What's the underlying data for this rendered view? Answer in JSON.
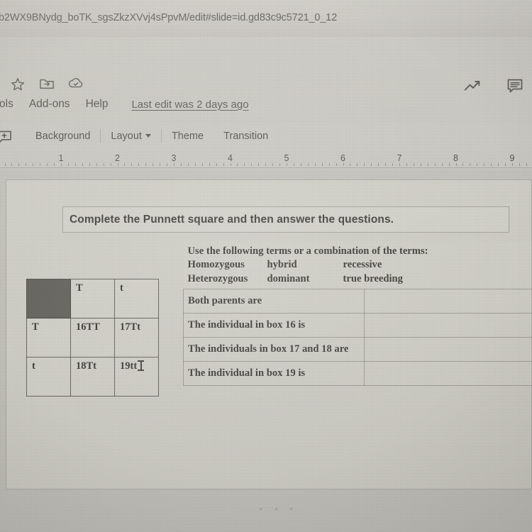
{
  "browser": {
    "url": "b2WX9BNydg_boTK_sgsZkzXVvj4sPpvM/edit#slide=id.gd83c9c5721_0_12"
  },
  "header": {
    "icons": [
      {
        "name": "star-icon",
        "label": "star"
      },
      {
        "name": "move-to-folder-icon",
        "label": "move to folder"
      },
      {
        "name": "cloud-saved-icon",
        "label": "saved to drive"
      }
    ],
    "menus": [
      {
        "label": "ols"
      },
      {
        "label": "Add-ons"
      },
      {
        "label": "Help"
      }
    ],
    "last_edit": "Last edit was 2 days ago",
    "right_icons": [
      {
        "name": "activity-trending-icon",
        "label": "activity dashboard"
      },
      {
        "name": "comment-icon",
        "label": "comments"
      }
    ]
  },
  "toolbar": {
    "new_slide_icon": "new-slide-icon",
    "items": [
      {
        "label": "Background",
        "caret": false
      },
      {
        "label": "Layout",
        "caret": true
      },
      {
        "label": "Theme",
        "caret": false
      },
      {
        "label": "Transition",
        "caret": false
      }
    ]
  },
  "ruler": {
    "numbers": [
      "1",
      "2",
      "3",
      "4",
      "5",
      "6",
      "7",
      "8",
      "9"
    ]
  },
  "slide": {
    "title": "Complete the Punnett square and then answer the questions.",
    "punnett": {
      "corner": "",
      "col_headers": [
        "T",
        "t"
      ],
      "row_headers": [
        "T",
        "t"
      ],
      "cells": [
        [
          "16TT",
          "17Tt"
        ],
        [
          "18Tt",
          "19tt"
        ]
      ],
      "cursor_cell": "19tt"
    },
    "terms": {
      "intro": "Use the following terms or a combination of the terms:",
      "col1": [
        "Homozygous",
        "Heterozygous"
      ],
      "col2": [
        "hybrid",
        "dominant"
      ],
      "col3": [
        "recessive",
        "true breeding"
      ]
    },
    "questions": [
      {
        "prompt": "Both parents are",
        "answer": ""
      },
      {
        "prompt": "The individual in box 16 is",
        "answer": ""
      },
      {
        "prompt": "The individuals in box 17 and 18 are",
        "answer": ""
      },
      {
        "prompt": "The individual in box 19 is",
        "answer": ""
      }
    ]
  },
  "colors": {
    "screen_bg": "#cbcac4",
    "slide_bg": "#d6d5cd",
    "punnett_corner": "#5e5d57",
    "text": "#33322c"
  }
}
